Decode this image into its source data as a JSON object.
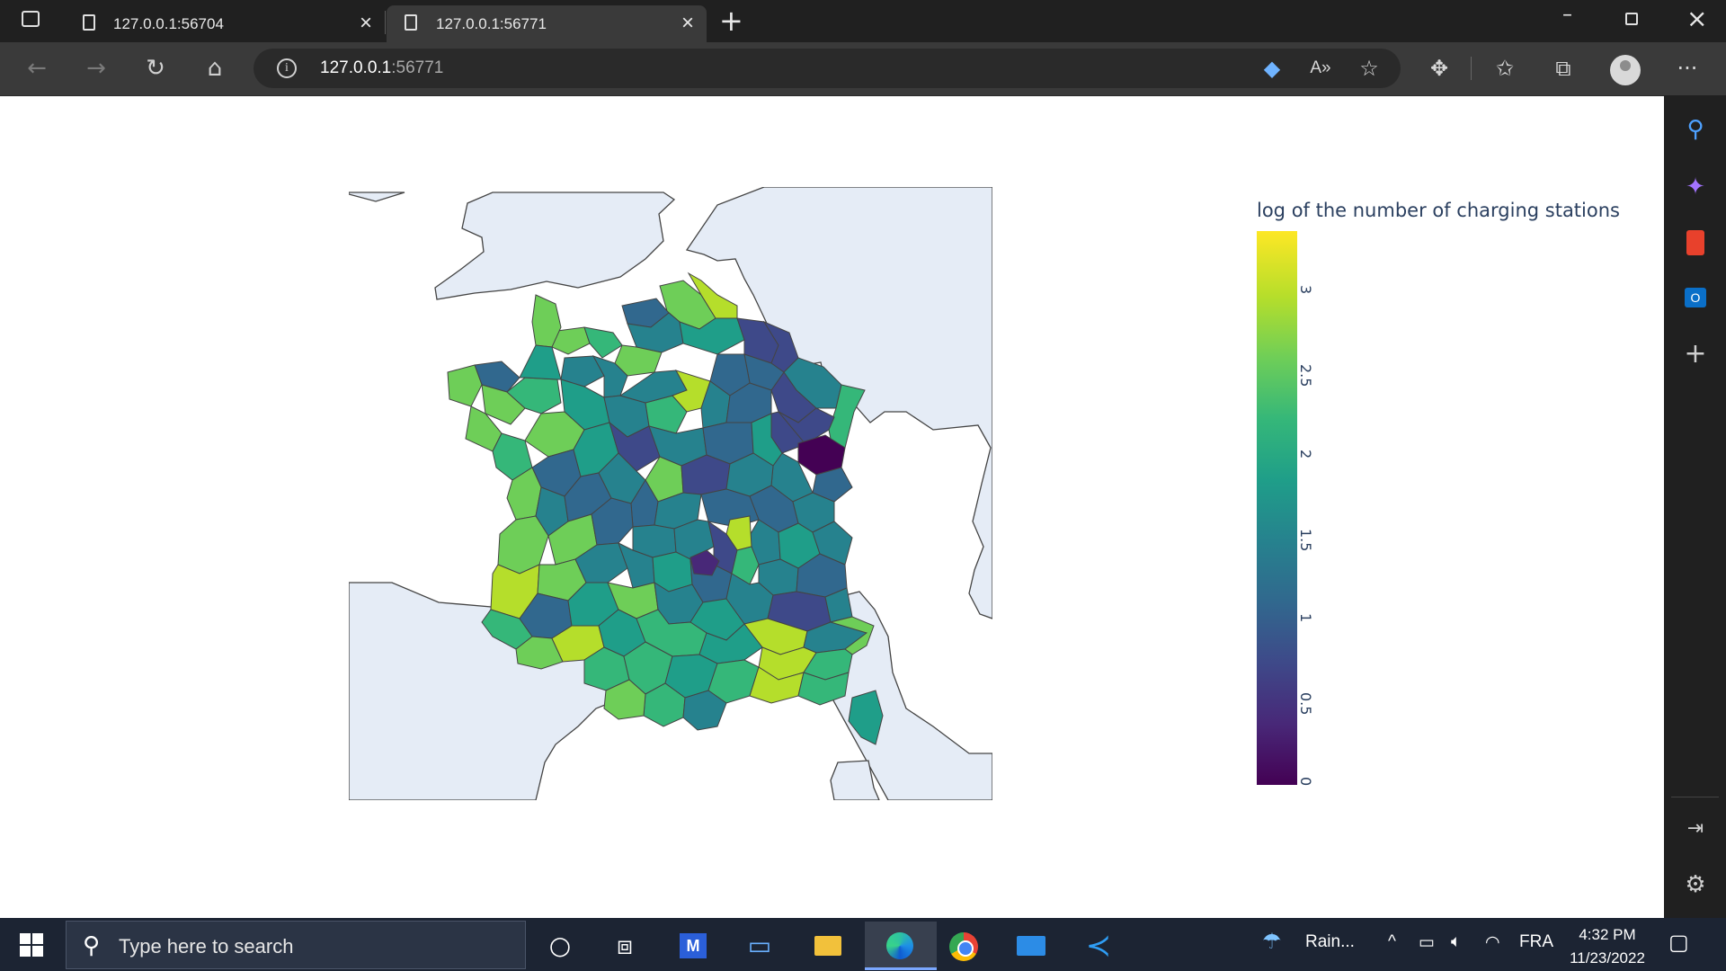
{
  "browser": {
    "tabs": [
      {
        "title": "127.0.0.1:56704",
        "active": false
      },
      {
        "title": "127.0.0.1:56771",
        "active": true
      }
    ],
    "url_host": "127.0.0.1",
    "url_port": ":56771",
    "new_tab_icon": "plus-icon",
    "window_controls": [
      "minimize-icon",
      "restore-icon",
      "close-icon"
    ],
    "nav_icons": [
      "back-icon",
      "forward-icon",
      "refresh-icon",
      "home-icon"
    ],
    "toolbar_icons": [
      "coupon-icon",
      "read-aloud-icon",
      "add-favorite-icon",
      "extensions-icon",
      "favorites-icon",
      "collections-icon",
      "profile-icon",
      "more-icon"
    ]
  },
  "sidebar": {
    "icons": [
      "search-icon",
      "copilot-icon",
      "office-icon",
      "outlook-icon",
      "add-icon",
      "hide-sidebar-icon",
      "settings-icon"
    ]
  },
  "chart_data": {
    "type": "choropleth",
    "region": "France (departments)",
    "colorbar": {
      "title": "log of the number of charging stations",
      "colorscale": "Viridis",
      "range": [
        0,
        3.35
      ],
      "ticks": [
        "0",
        "0.5",
        "1",
        "1.5",
        "2",
        "2.5",
        "3"
      ],
      "colors": [
        "#440154",
        "#482878",
        "#3e4989",
        "#31688e",
        "#26828e",
        "#1f9e89",
        "#35b779",
        "#6ece58",
        "#b5de2b",
        "#fde725"
      ]
    },
    "land_color": "#e5ecf6",
    "border_color": "#444444"
  },
  "taskbar": {
    "search_placeholder": "Type here to search",
    "apps": [
      "cortana-icon",
      "task-view-icon",
      "app-icon",
      "pc-icon",
      "file-explorer-icon",
      "edge-icon",
      "chrome-icon",
      "mail-icon",
      "vscode-icon"
    ],
    "weather": "Rain...",
    "language": "FRA",
    "time": "4:32 PM",
    "date": "11/23/2022"
  }
}
